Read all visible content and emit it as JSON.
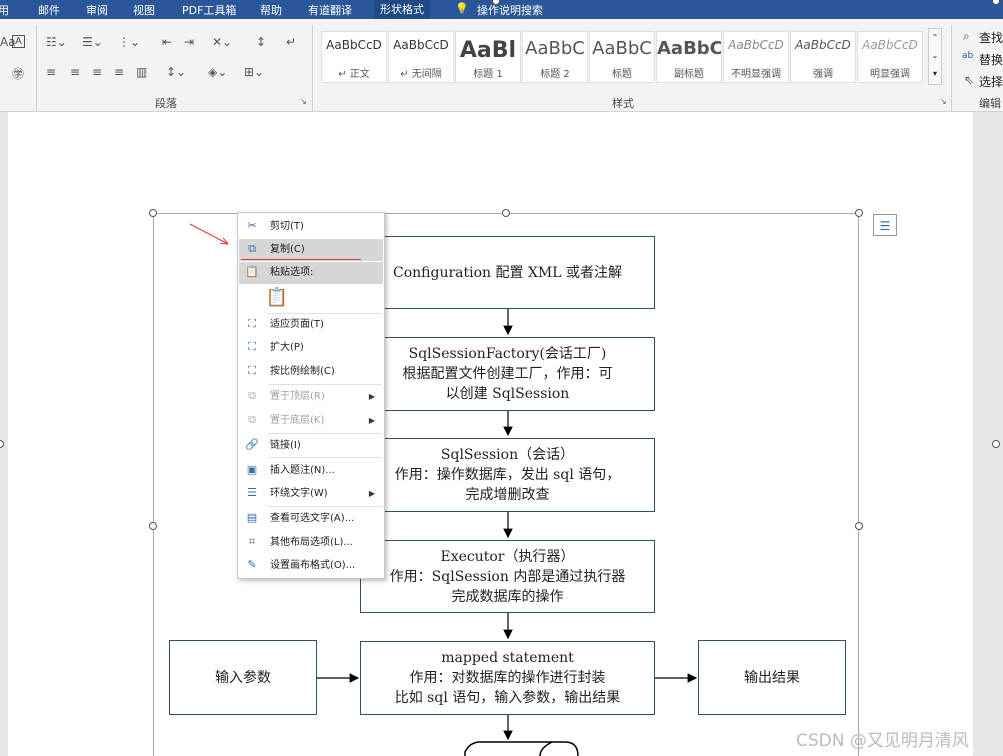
{
  "tabs": [
    "用",
    "邮件",
    "审阅",
    "视图",
    "PDF工具箱",
    "帮助",
    "有道翻译",
    "形状格式"
  ],
  "tell_me": "操作说明搜索",
  "ribbon": {
    "paragraph_label": "段落",
    "styles_label": "样式",
    "edit_label": "编辑",
    "find": "查找",
    "replace": "替换",
    "select": "选择",
    "styles": [
      {
        "sample": "AaBbCcD",
        "name": "↵ 正文"
      },
      {
        "sample": "AaBbCcD",
        "name": "↵ 无间隔"
      },
      {
        "sample": "AaBl",
        "name": "标题 1"
      },
      {
        "sample": "AaBbC",
        "name": "标题 2"
      },
      {
        "sample": "AaBbC",
        "name": "标题"
      },
      {
        "sample": "AaBbC",
        "name": "副标题"
      },
      {
        "sample": "AaBbCcD",
        "name": "不明显强调"
      },
      {
        "sample": "AaBbCcD",
        "name": "强调"
      },
      {
        "sample": "AaBbCcD",
        "name": "明显强调"
      }
    ]
  },
  "flow": {
    "config": "Configuration 配置 XML 或者注解",
    "factory": [
      "SqlSessionFactory(会话工厂)",
      "根据配置文件创建工厂，作用：可",
      "以创建 SqlSession"
    ],
    "session": [
      "SqlSession（会话）",
      "作用：操作数据库，发出 sql 语句，",
      "完成增删改查"
    ],
    "executor": [
      "Executor（执行器）",
      "作用：SqlSession 内部是通过执行器",
      "完成数据库的操作"
    ],
    "mapped": [
      "mapped statement",
      "作用：对数据库的操作进行封装",
      "比如 sql 语句，输入参数，输出结果"
    ],
    "input": "输入参数",
    "output": "输出结果"
  },
  "menu": {
    "cut": "剪切(T)",
    "copy": "复制(C)",
    "paste_options": "粘贴选项:",
    "fit": "适应页面(T)",
    "expand": "扩大(P)",
    "scale": "按比例绘制(C)",
    "bring_front": "置于顶层(R)",
    "send_back": "置于底层(K)",
    "link": "链接(I)",
    "caption": "插入题注(N)...",
    "wrap": "环绕文字(W)",
    "alt_text": "查看可选文字(A)...",
    "layout": "其他布局选项(L)...",
    "format": "设置画布格式(O)..."
  },
  "watermark": "CSDN @又见明月清风"
}
